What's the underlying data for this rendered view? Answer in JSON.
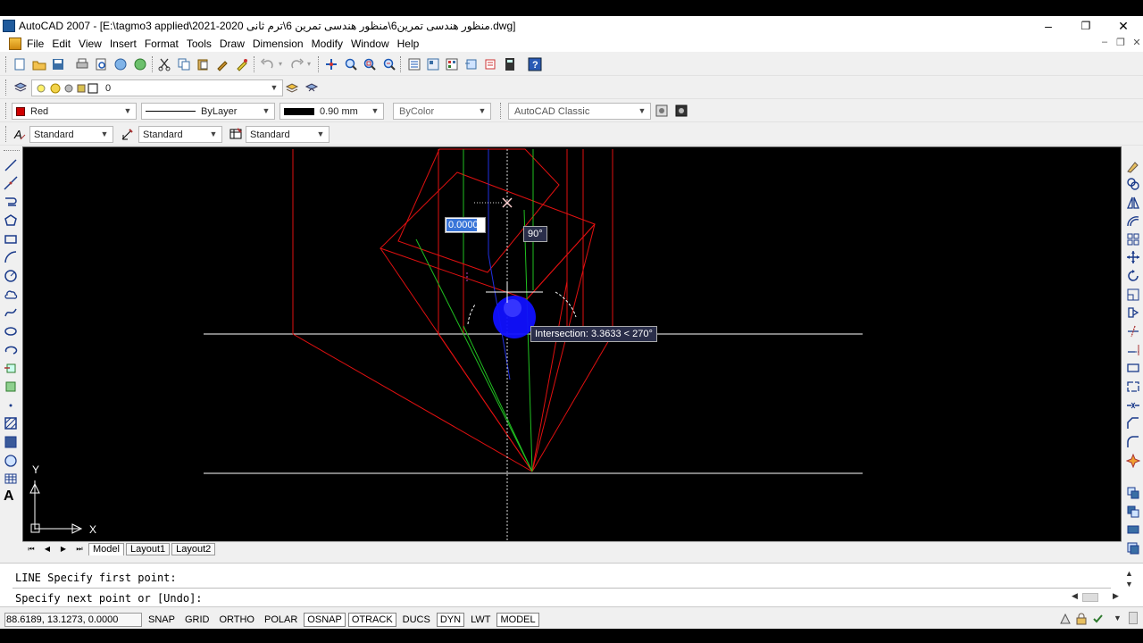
{
  "window": {
    "title": "AutoCAD 2007 - [E:\\tagmo3 applied\\منظور هندسی تمرین6\\منظور هندسی تمرین 6\\ترم ثانی 2020-2021.dwg]",
    "min_icon": "minimize-icon",
    "max_icon": "restore-icon",
    "close_icon": "close-icon"
  },
  "menu": {
    "items": [
      "File",
      "Edit",
      "View",
      "Insert",
      "Format",
      "Tools",
      "Draw",
      "Dimension",
      "Modify",
      "Window",
      "Help"
    ]
  },
  "layers": {
    "current_layer": "0"
  },
  "properties": {
    "color": "Red",
    "color_hex": "#d00000",
    "linetype": "ByLayer",
    "lineweight": "0.90 mm",
    "plotstyle": "ByColor",
    "workspace": "AutoCAD Classic"
  },
  "styles": {
    "text_style": "Standard",
    "dim_style": "Standard",
    "table_style": "Standard"
  },
  "canvas": {
    "input_value": "0.0000",
    "angle_label": "90°",
    "tooltip": "Intersection: 3.3633 < 270°",
    "ucs_y": "Y",
    "ucs_x": "X"
  },
  "tabs": {
    "model": "Model",
    "layout1": "Layout1",
    "layout2": "Layout2"
  },
  "command": {
    "line1": "LINE Specify first point:",
    "line2": "Specify next point or [Undo]:"
  },
  "status": {
    "coords": "88.6189, 13.1273, 0.0000",
    "snap": "SNAP",
    "grid": "GRID",
    "ortho": "ORTHO",
    "polar": "POLAR",
    "osnap": "OSNAP",
    "otrack": "OTRACK",
    "ducs": "DUCS",
    "dyn": "DYN",
    "lwt": "LWT",
    "model": "MODEL"
  }
}
